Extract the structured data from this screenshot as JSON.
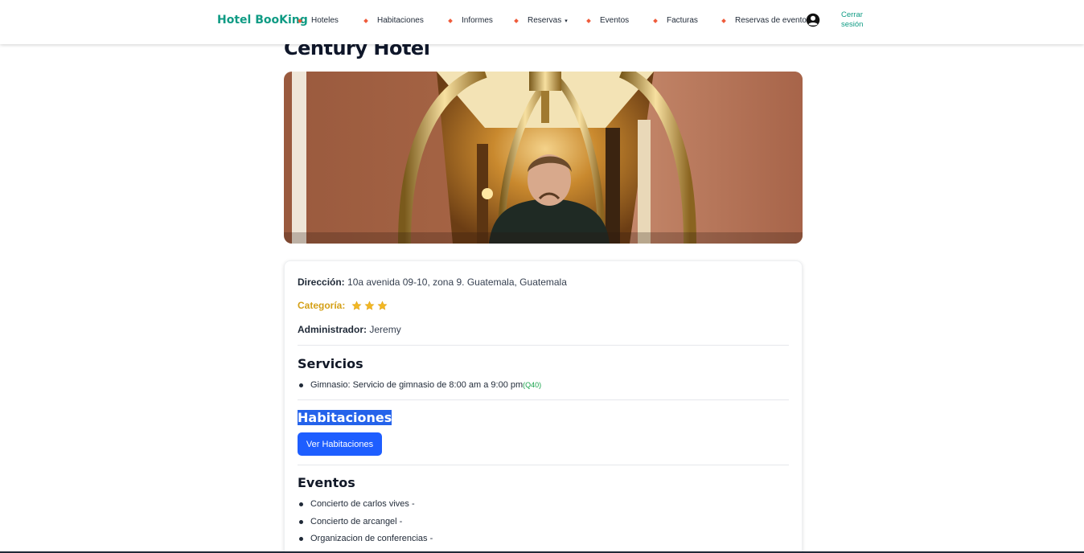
{
  "navbar": {
    "brand": "Hotel BooKing",
    "items": [
      {
        "label": "Hoteles"
      },
      {
        "label": "Habitaciones"
      },
      {
        "label": "Informes"
      },
      {
        "label": "Reservas",
        "caret": "▾"
      },
      {
        "label": "Eventos"
      },
      {
        "label": "Facturas"
      },
      {
        "label": "Reservas de eventos"
      }
    ],
    "user_icon": "user-circle-icon",
    "logout_line1": "Cerrar",
    "logout_line2": "sesión"
  },
  "hotel": {
    "name": "Century Hotel",
    "image": "bellhop-luggage-cart-photo",
    "address_label": "Dirección:",
    "address": "10a avenida 09-10, zona 9. Guatemala, Guatemala",
    "category_label": "Categoría:",
    "category_stars": 3,
    "admin_label": "Administrador:",
    "admin": "Jeremy"
  },
  "services": {
    "title": "Servicios",
    "items": [
      {
        "name": "Gimnasio:",
        "description": "Servicio de gimnasio de 8:00 am a 9:00 pm",
        "price": "(Q40)"
      }
    ]
  },
  "rooms": {
    "title": "Habitaciones",
    "button_label": "Ver Habitaciones"
  },
  "events": {
    "title": "Eventos",
    "items": [
      {
        "label": "Concierto de carlos vives -"
      },
      {
        "label": "Concierto de arcangel -"
      },
      {
        "label": "Organizacion de conferencias -"
      }
    ]
  },
  "colors": {
    "brand": "#0f9b84",
    "button": "#1e5eff",
    "star": "#f2b824",
    "nav_bullet": "#ef5b3b",
    "price": "#16a34a"
  }
}
